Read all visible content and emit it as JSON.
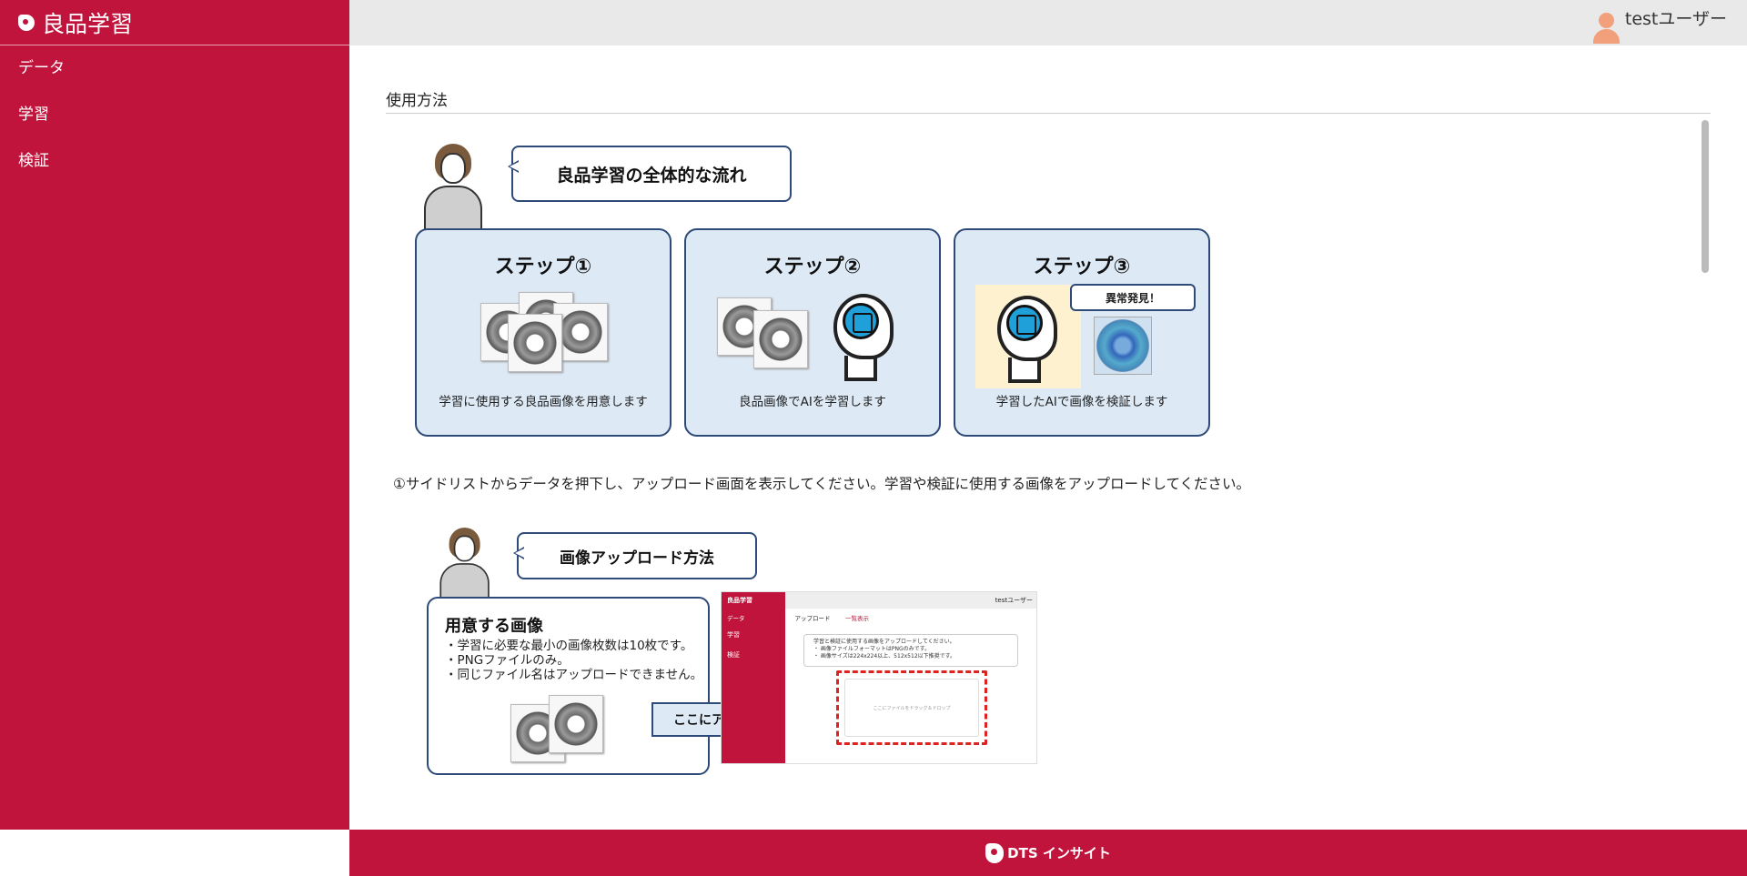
{
  "app": {
    "title": "良品学習"
  },
  "sidebar": {
    "items": [
      {
        "label": "データ"
      },
      {
        "label": "学習"
      },
      {
        "label": "検証"
      }
    ]
  },
  "header": {
    "user": "testユーザー"
  },
  "main": {
    "section_title": "使用方法",
    "guide": {
      "flow_title": "良品学習の全体的な流れ",
      "steps": [
        {
          "title": "ステップ①",
          "caption": "学習に使用する良品画像を用意します"
        },
        {
          "title": "ステップ②",
          "caption": "良品画像でAIを学習します"
        },
        {
          "title": "ステップ③",
          "caption": "学習したAIで画像を検証します"
        }
      ],
      "anomaly_label": "異常発見！",
      "intro_text": "①サイドリストからデータを押下し、アップロード画面を表示してください。学習や検証に使用する画像をアップロードしてください。",
      "upload_title": "画像アップロード方法",
      "prepare": {
        "title": "用意する画像",
        "items": [
          "・学習に必要な最小の画像枚数は10枚です。",
          "・PNGファイルのみ。",
          "・同じファイル名はアップロードできません。"
        ]
      },
      "upload_here": "ここにアップロード",
      "mini_screen": {
        "app_title": "良品学習",
        "user": "testユーザー",
        "tabs": [
          "データ",
          "アップロード",
          "一覧表示"
        ],
        "side_items": [
          "学習",
          "検証"
        ],
        "info_lines": [
          "学習と検証に使用する画像をアップロードしてください。",
          "・ 画像ファイルフォーマットはPNGのみです。",
          "・ 画像サイズは224x224以上、512x512以下推奨です。"
        ],
        "drop_hint": "ここにファイルをドラッグ＆ドロップ"
      }
    }
  },
  "footer": {
    "brand": "DTS インサイト"
  },
  "colors": {
    "brand": "#c0143c",
    "card_bg": "#dde9f5",
    "card_border": "#2d4a78",
    "topbar": "#e9e9e9"
  },
  "icons": {
    "user": "user-avatar-icon",
    "logo": "brand-logo-icon"
  }
}
